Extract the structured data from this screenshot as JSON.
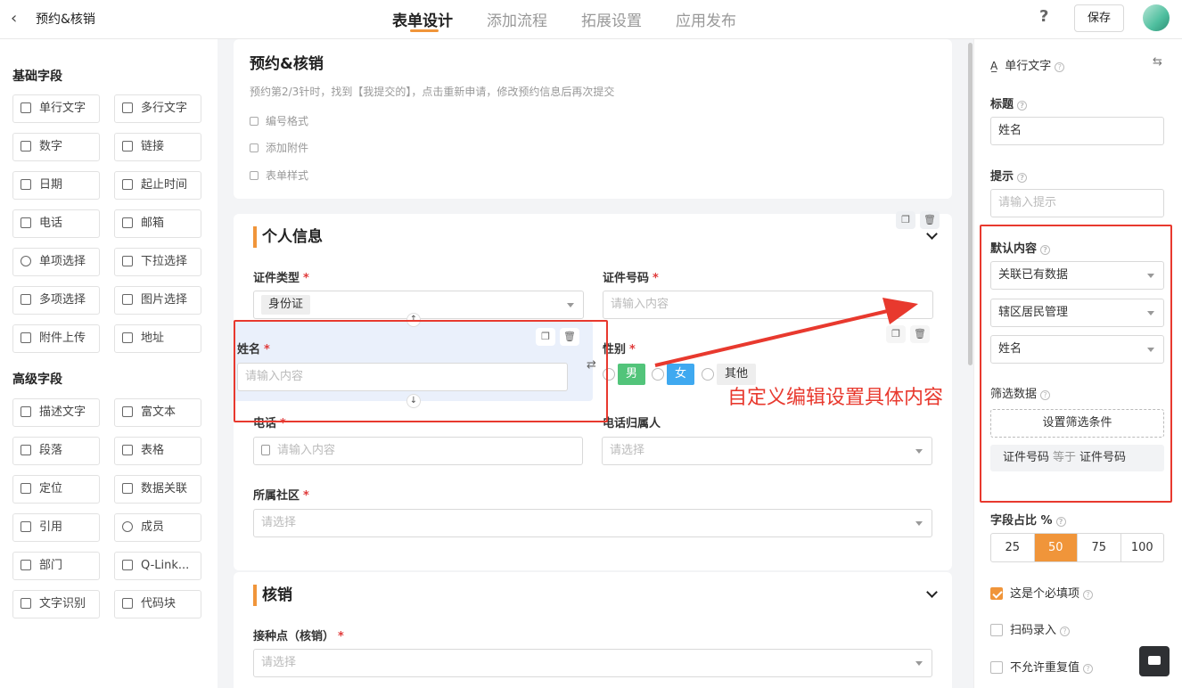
{
  "header": {
    "back_icon": "chevron-left-icon",
    "title": "预约&核销",
    "tabs": [
      "表单设计",
      "添加流程",
      "拓展设置",
      "应用发布"
    ],
    "active_tab": 0,
    "help": "?",
    "save": "保存"
  },
  "palette": {
    "basic_title": "基础字段",
    "basic": [
      "单行文字",
      "多行文字",
      "数字",
      "链接",
      "日期",
      "起止时间",
      "电话",
      "邮箱",
      "单项选择",
      "下拉选择",
      "多项选择",
      "图片选择",
      "附件上传",
      "地址"
    ],
    "advanced_title": "高级字段",
    "advanced": [
      "描述文字",
      "富文本",
      "段落",
      "表格",
      "定位",
      "数据关联",
      "引用",
      "成员",
      "部门",
      "Q-Link...",
      "文字识别",
      "代码块"
    ]
  },
  "form": {
    "title": "预约&核销",
    "description": "预约第2/3针时，找到【我提交的】，点击重新申请，修改预约信息后再次提交",
    "options": [
      "编号格式",
      "添加附件",
      "表单样式"
    ],
    "section1": "个人信息",
    "id_type_label": "证件类型",
    "id_type_value": "身份证",
    "id_no_label": "证件号码",
    "id_no_placeholder": "请输入内容",
    "name_label": "姓名",
    "name_placeholder": "请输入内容",
    "gender_label": "性别",
    "gender_options": [
      "男",
      "女",
      "其他"
    ],
    "phone_label": "电话",
    "phone_placeholder": "请输入内容",
    "owner_label": "电话归属人",
    "owner_placeholder": "请选择",
    "community_label": "所属社区",
    "community_placeholder": "请选择",
    "section2": "核销",
    "site_label": "接种点（核销）",
    "site_placeholder": "请选择",
    "required_mark": "*"
  },
  "annotation": "自定义编辑设置具体内容",
  "props": {
    "field_type": "单行文字",
    "title_label": "标题",
    "title_value": "姓名",
    "hint_label": "提示",
    "hint_placeholder": "请输入提示",
    "default_label": "默认内容",
    "default_selects": [
      "关联已有数据",
      "辖区居民管理",
      "姓名"
    ],
    "filter_label": "筛选数据",
    "filter_btn": "设置筛选条件",
    "condition": {
      "left": "证件号码",
      "op": "等于",
      "right": "证件号码"
    },
    "ratio_label": "字段占比 %",
    "ratios": [
      "25",
      "50",
      "75",
      "100"
    ],
    "ratio_selected": 1,
    "checks": [
      {
        "label": "这是个必填项",
        "checked": true
      },
      {
        "label": "扫码录入",
        "checked": false
      },
      {
        "label": "不允许重复值",
        "checked": false
      }
    ]
  },
  "colors": {
    "accent": "#f0953a",
    "annotation": "#e8392e",
    "male": "#52c47a",
    "female": "#3fa9f0"
  }
}
